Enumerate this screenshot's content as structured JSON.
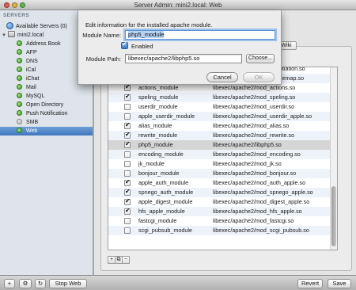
{
  "window": {
    "title": "Server Admin: mini2.local: Web"
  },
  "sidebar": {
    "header": "SERVERS",
    "available_servers": "Available Servers (0)",
    "server": "mini2.local",
    "services": [
      {
        "label": "Address Book",
        "status": "running"
      },
      {
        "label": "AFP",
        "status": "running"
      },
      {
        "label": "DNS",
        "status": "running"
      },
      {
        "label": "iCal",
        "status": "running"
      },
      {
        "label": "iChat",
        "status": "running"
      },
      {
        "label": "Mail",
        "status": "running"
      },
      {
        "label": "MySQL",
        "status": "running"
      },
      {
        "label": "Open Directory",
        "status": "running"
      },
      {
        "label": "Push Notification",
        "status": "running"
      },
      {
        "label": "SMB",
        "status": "stopped"
      },
      {
        "label": "Web",
        "status": "running"
      }
    ]
  },
  "main": {
    "tab_wiki": "Wiki",
    "modules": [
      {
        "enabled": false,
        "name": "",
        "path": "libexec/apache2/mod_negotiation.so"
      },
      {
        "enabled": false,
        "name": "",
        "path": "libexec/apache2/mod_imagemap.so"
      },
      {
        "enabled": true,
        "name": "actions_module",
        "path": "libexec/apache2/mod_actions.so"
      },
      {
        "enabled": true,
        "name": "speling_module",
        "path": "libexec/apache2/mod_speling.so"
      },
      {
        "enabled": false,
        "name": "userdir_module",
        "path": "libexec/apache2/mod_userdir.so"
      },
      {
        "enabled": false,
        "name": "apple_userdir_module",
        "path": "libexec/apache2/mod_userdir_apple.so"
      },
      {
        "enabled": true,
        "name": "alias_module",
        "path": "libexec/apache2/mod_alias.so"
      },
      {
        "enabled": true,
        "name": "rewrite_module",
        "path": "libexec/apache2/mod_rewrite.so"
      },
      {
        "enabled": true,
        "name": "php5_module",
        "path": "libexec/apache2/libphp5.so",
        "selected": true
      },
      {
        "enabled": false,
        "name": "encoding_module",
        "path": "libexec/apache2/mod_encoding.so"
      },
      {
        "enabled": false,
        "name": "jk_module",
        "path": "libexec/apache2/mod_jk.so"
      },
      {
        "enabled": false,
        "name": "bonjour_module",
        "path": "libexec/apache2/mod_bonjour.so"
      },
      {
        "enabled": true,
        "name": "apple_auth_module",
        "path": "libexec/apache2/mod_auth_apple.so"
      },
      {
        "enabled": true,
        "name": "spnego_auth_module",
        "path": "libexec/apache2/mod_spnego_apple.so"
      },
      {
        "enabled": true,
        "name": "apple_digest_module",
        "path": "libexec/apache2/mod_digest_apple.so"
      },
      {
        "enabled": true,
        "name": "hfs_apple_module",
        "path": "libexec/apache2/mod_hfs_apple.so"
      },
      {
        "enabled": false,
        "name": "fastcgi_module",
        "path": "libexec/apache2/mod_fastcgi.so"
      },
      {
        "enabled": false,
        "name": "scgi_pubsub_module",
        "path": "libexec/apache2/mod_scgi_pubsub.so"
      }
    ],
    "add_icon": "+",
    "duplicate_icon": "⧉",
    "remove_icon": "−"
  },
  "bottom": {
    "add_icon": "+",
    "gear_icon": "⚙",
    "refresh_icon": "↻",
    "stop_label": "Stop Web",
    "revert_label": "Revert",
    "save_label": "Save"
  },
  "dialog": {
    "title": "Edit information for the installed apache module.",
    "name_label": "Module Name:",
    "name_value": "php5_module",
    "enabled_label": "Enabled",
    "path_label": "Module Path:",
    "path_value": "libexec/apache2/libphp5.so",
    "choose_label": "Choose...",
    "cancel_label": "Cancel",
    "ok_label": "OK"
  }
}
